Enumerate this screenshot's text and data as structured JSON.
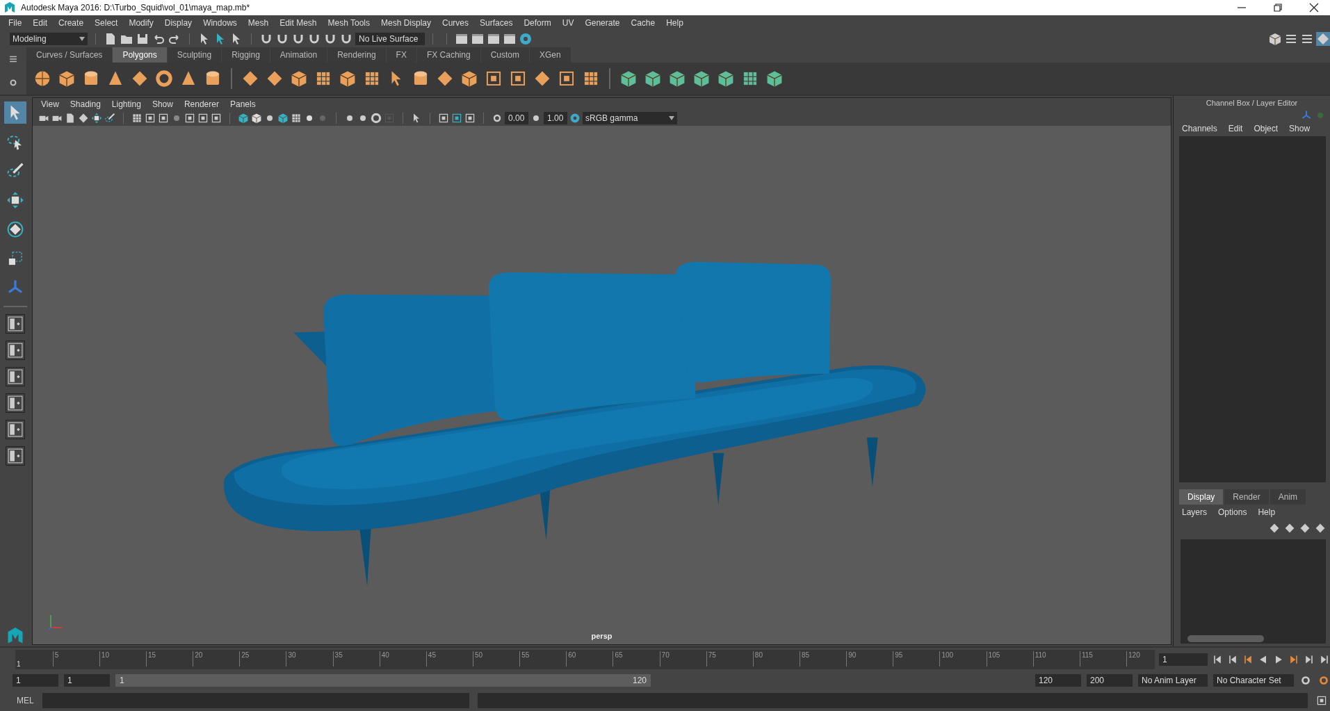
{
  "window": {
    "title": "Autodesk Maya 2016: D:\\Turbo_Squid\\vol_01\\maya_map.mb*"
  },
  "menu": [
    "File",
    "Edit",
    "Create",
    "Select",
    "Modify",
    "Display",
    "Windows",
    "Mesh",
    "Edit Mesh",
    "Mesh Tools",
    "Mesh Display",
    "Curves",
    "Surfaces",
    "Deform",
    "UV",
    "Generate",
    "Cache",
    "Help"
  ],
  "status_line": {
    "mode": "Modeling",
    "live_surface": "No Live Surface"
  },
  "shelf_tabs": [
    {
      "label": "Curves / Surfaces",
      "selected": false
    },
    {
      "label": "Polygons",
      "selected": true
    },
    {
      "label": "Sculpting",
      "selected": false
    },
    {
      "label": "Rigging",
      "selected": false
    },
    {
      "label": "Animation",
      "selected": false
    },
    {
      "label": "Rendering",
      "selected": false
    },
    {
      "label": "FX",
      "selected": false
    },
    {
      "label": "FX Caching",
      "selected": false
    },
    {
      "label": "Custom",
      "selected": false
    },
    {
      "label": "XGen",
      "selected": false
    }
  ],
  "viewport": {
    "menu": [
      "View",
      "Shading",
      "Lighting",
      "Show",
      "Renderer",
      "Panels"
    ],
    "exposure": "0.00",
    "gamma": "1.00",
    "color_space": "sRGB gamma",
    "camera": "persp"
  },
  "channel_box": {
    "title": "Channel Box / Layer Editor",
    "menu": [
      "Channels",
      "Edit",
      "Object",
      "Show"
    ]
  },
  "layer_editor": {
    "tabs": [
      {
        "label": "Display",
        "selected": true
      },
      {
        "label": "Render",
        "selected": false
      },
      {
        "label": "Anim",
        "selected": false
      }
    ],
    "menu": [
      "Layers",
      "Options",
      "Help"
    ]
  },
  "timeline": {
    "ticks": [
      "5",
      "10",
      "15",
      "20",
      "25",
      "30",
      "35",
      "40",
      "45",
      "50",
      "55",
      "60",
      "65",
      "70",
      "75",
      "80",
      "85",
      "90",
      "95",
      "100",
      "105",
      "110",
      "115",
      "120"
    ],
    "start_label": "1",
    "current_frame": "1"
  },
  "range": {
    "level": 1,
    "start": "1",
    "playback_start": "1",
    "slider_start": "1",
    "slider_end": "120",
    "playback_end": "120",
    "end": "200",
    "anim_layer": "No Anim Layer",
    "character_set": "No Character Set"
  },
  "command_line": {
    "label": "MEL"
  }
}
